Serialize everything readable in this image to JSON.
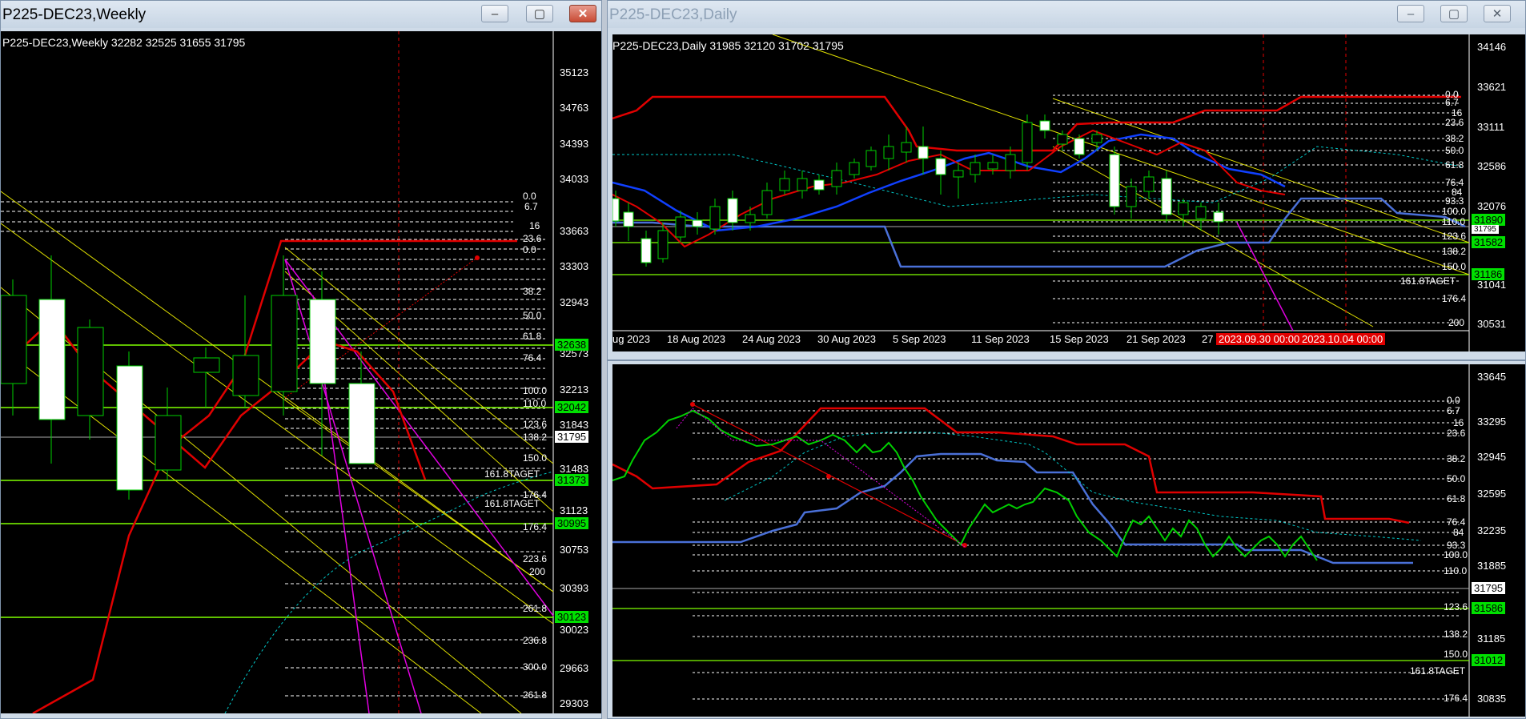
{
  "weekly": {
    "title": "P225-DEC23,Weekly",
    "info": "P225-DEC23,Weekly  32282 32525 31655 31795",
    "prices": [
      "35123",
      "34763",
      "34393",
      "34033",
      "33663",
      "33303",
      "32943",
      "32573",
      "32213",
      "31843",
      "31483",
      "31123",
      "30753",
      "30393",
      "30023",
      "29663",
      "29303"
    ],
    "current": "31795",
    "green_tags": [
      "32638",
      "32042",
      "31373",
      "30995",
      "30123"
    ],
    "fibs_a": [
      "0.0",
      "6.7",
      "16",
      "23.6",
      "0.0",
      "6.7",
      "16",
      "23.6",
      "38.2",
      "50.0",
      "61.8",
      "76.4",
      "84",
      "93.3",
      "100.0",
      "110.0",
      "123.6",
      "138.2",
      "150.0",
      "161.8TAGET",
      "176.4"
    ],
    "fibs_b": [
      "161.8TAGET",
      "176.4",
      "200",
      "223.6",
      "238.2",
      "261.8",
      "236.8",
      "300.0",
      "261.8"
    ]
  },
  "daily": {
    "title": "P225-DEC23,Daily",
    "info": "P225-DEC23,Daily  31985 32120 31702 31795",
    "prices": [
      "34146",
      "33621",
      "33111",
      "32586",
      "32076",
      "31556",
      "31041",
      "30531"
    ],
    "green_tags": [
      "31890",
      "31582",
      "31186"
    ],
    "current": "31795",
    "fibs": [
      "0.0",
      "6.7",
      "16",
      "23.6",
      "38.2",
      "50.0",
      "61.8",
      "76.4",
      "84",
      "93.3",
      "100.0",
      "110.0",
      "123.6",
      "138.2",
      "150.0",
      "161.8TAGET",
      "176.4",
      "200"
    ],
    "dates": [
      "ug 2023",
      "18 Aug 2023",
      "24 Aug 2023",
      "30 Aug 2023",
      "5 Sep 2023",
      "11 Sep 2023",
      "15 Sep 2023",
      "21 Sep 2023",
      "27"
    ],
    "date_tags": [
      "2023.09.30 00:00",
      "2023.10.04 00:00"
    ]
  },
  "intraday": {
    "prices": [
      "33645",
      "33295",
      "32945",
      "32595",
      "32235",
      "31885",
      "31535",
      "31185",
      "30835"
    ],
    "current": "31795",
    "green_tags": [
      "31586",
      "31012"
    ],
    "fibs": [
      "0.0",
      "6.7",
      "16",
      "23.6",
      "38.2",
      "50.0",
      "61.8",
      "76.4",
      "84",
      "93.3",
      "100.0",
      "110.0",
      "123.6",
      "138.2",
      "150.0",
      "161.8TAGET",
      "176.4"
    ]
  },
  "colors": {
    "bull": "#00d000",
    "bear_body": "#ffffff",
    "tenkan": "#e00000",
    "kijun": "#1040ff",
    "span": "#4a70d8",
    "fib": "#ffffff",
    "trend": "#e0e000"
  }
}
